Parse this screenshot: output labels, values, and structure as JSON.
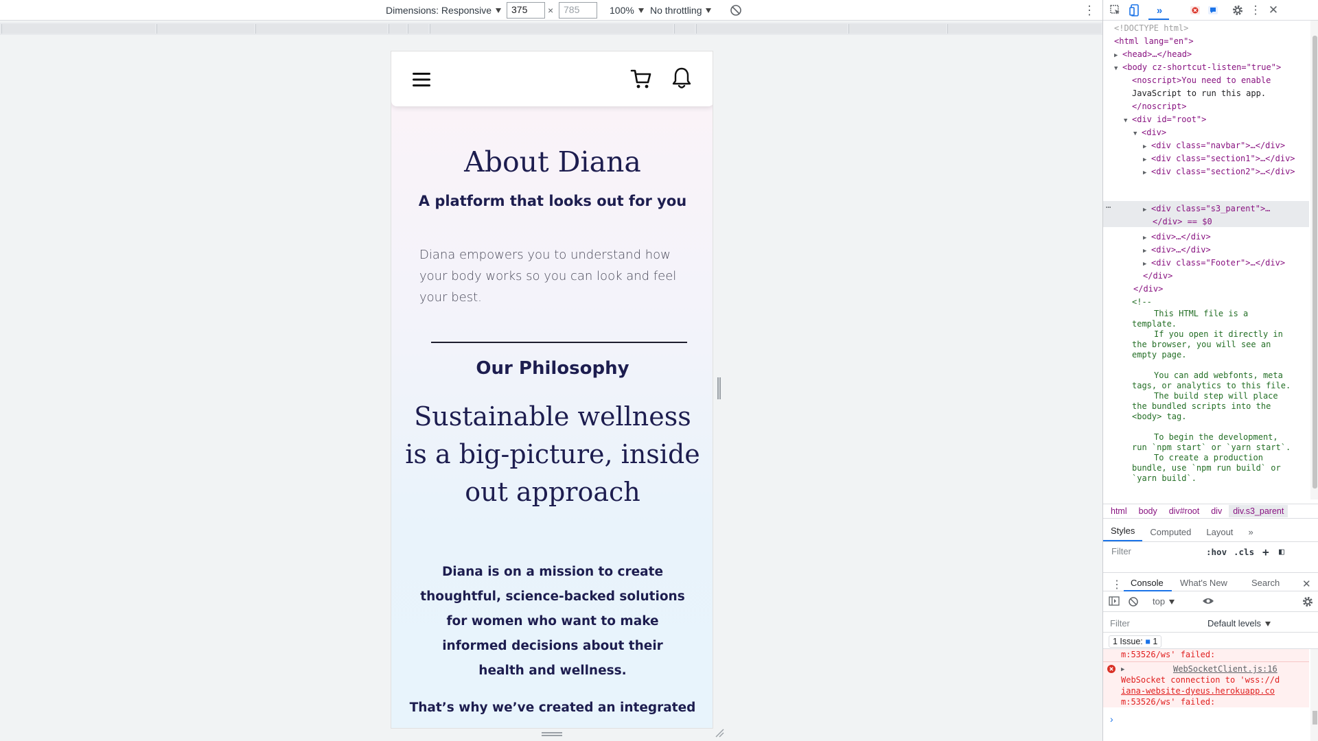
{
  "toolbar": {
    "dimensions_label": "Dimensions: Responsive",
    "width": "375",
    "height_placeholder": "785",
    "times": "×",
    "zoom": "100%",
    "throttling": "No throttling"
  },
  "device_page": {
    "about_title": "About Diana",
    "about_subtitle": "A platform that looks out for you",
    "about_body": "Diana empowers you to understand how your body works so you can look and feel your best.",
    "philosophy_title": "Our Philosophy",
    "philosophy_heading": "Sustainable wellness is a big-picture, inside out approach",
    "mission": "Diana is on a mission to create thoughtful, science-backed solutions for women who want to make informed decisions about their health and wellness.",
    "that_why": "That’s why we’ve created an integrated"
  },
  "devtools": {
    "elements": {
      "doctype": "<!DOCTYPE html>",
      "html_open": "<html lang=\"en\">",
      "head": "<head>…</head>",
      "body_open": "<body cz-shortcut-listen=\"true\">",
      "noscript_1": "<noscript>You need to enable",
      "noscript_2": "JavaScript to run this app.",
      "noscript_3": "</noscript>",
      "root_open": "<div id=\"root\">",
      "div_open": "<div>",
      "navbar": "<div class=\"navbar\">…</div>",
      "section1": "<div class=\"section1\">…</div>",
      "section2": "<div class=\"section2\">…</div>",
      "s3_parent": "<div class=\"s3_parent\">…",
      "s3_close": "</div> == $0",
      "div_a": "<div>…</div>",
      "div_b": "<div>…</div>",
      "footer": "<div class=\"Footer\">…</div>",
      "div_close": "</div>",
      "root_close": "</div>",
      "comment_open": "<!--",
      "comment_lines": [
        "This HTML file is a",
        "template.",
        "If you open it directly in",
        "the browser, you will see an",
        "empty page.",
        "",
        "You can add webfonts, meta",
        "tags, or analytics to this file.",
        "The build step will place",
        "the bundled scripts into the",
        "<body> tag.",
        "",
        "To begin the development,",
        "run `npm start` or `yarn start`.",
        "To create a production",
        "bundle, use `npm run build` or",
        "`yarn build`."
      ]
    },
    "breadcrumbs": [
      "html",
      "body",
      "div#root",
      "div",
      "div.s3_parent"
    ],
    "styles_tabs": [
      "Styles",
      "Computed",
      "Layout"
    ],
    "styles_filter_placeholder": "Filter",
    "hov": ":hov",
    "cls": ".cls",
    "drawer_tabs": [
      "Console",
      "What's New",
      "Search"
    ],
    "console_context": "top",
    "console_filter_placeholder": "Filter",
    "default_levels": "Default levels",
    "issues_label": "1 Issue:",
    "issues_count": "1",
    "error_prev_tail": "m:53526/ws' failed:",
    "error_source": "WebSocketClient.js:16",
    "error_line1": "WebSocket connection to 'wss://d",
    "error_line2": "iana-website-dyeus.herokuapp.co",
    "error_line3": "m:53526/ws' failed:"
  },
  "colors": {
    "brand_navy": "#1d1d4f",
    "devtools_blue": "#1a73e8",
    "error_red": "#e02020"
  }
}
